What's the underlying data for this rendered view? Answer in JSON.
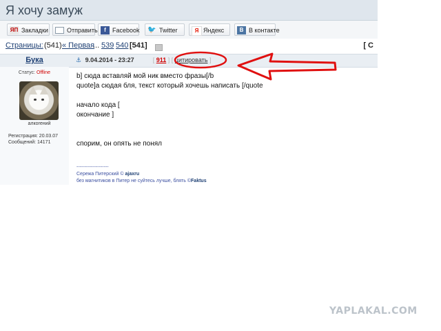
{
  "page_title": "Я хочу замуж",
  "share": {
    "bookmarks": "Закладки",
    "send": "Отправить",
    "facebook": "Facebook",
    "twitter": "Twitter",
    "yandex": "Яндекс",
    "vkontakte": "В контакте",
    "icons": {
      "bookmarks": "ЯП",
      "facebook": "f",
      "vkontakte": "B"
    }
  },
  "pager": {
    "label": "Страницы:",
    "count": "(541)",
    "first": "« Первая",
    "ellipsis": "...",
    "p1": "539",
    "p2": "540",
    "current": "[541]",
    "right_marker": "[ С"
  },
  "post": {
    "author": "Бука",
    "anchor": "⚓",
    "date": "9.04.2014 - 23:27",
    "rating_open": "[",
    "rating": "911",
    "rating_close": "]",
    "quote_open": "[",
    "quote": "цитировать",
    "quote_close": "]",
    "status_label": "Статус:",
    "status_value": "Offline",
    "avatar_caption": "алкогений",
    "registration": "Регистрация: 20.03.07",
    "messages": "Сообщений: 14171",
    "body": {
      "line1": "b] сюда вставляй мой ник вместо фразы[/b",
      "line2": "quote]а сюдая бля, текст который хочешь написать [/quote",
      "line3": "начало кода [",
      "line4": "окончание ]",
      "line5": "спорим, он опять не понял"
    },
    "signature": {
      "rule": "--------------------",
      "line1_prefix": "Сережа Питерский ©",
      "line1_name": "ajaxru",
      "line2_prefix": "без магнитиков в Питер не суйтесь лучше, блять ©",
      "line2_name": "Faktus"
    }
  },
  "watermark": "YAPLAKAL.COM",
  "colors": {
    "annotation_red": "#e01010"
  }
}
